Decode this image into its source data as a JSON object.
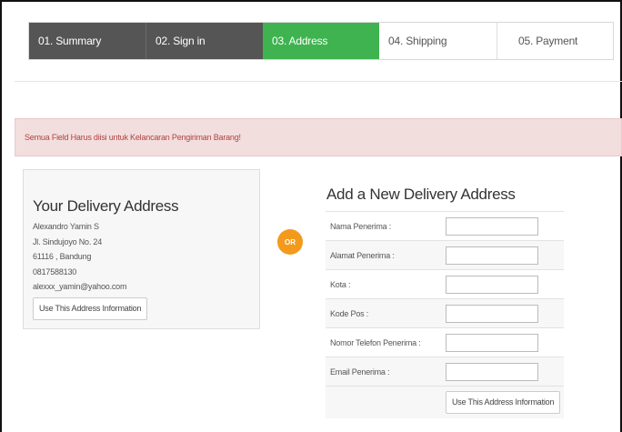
{
  "steps": [
    {
      "label": "01. Summary",
      "state": "done"
    },
    {
      "label": "02. Sign in",
      "state": "done"
    },
    {
      "label": "03. Address",
      "state": "active"
    },
    {
      "label": "04. Shipping",
      "state": "todo"
    },
    {
      "label": "05. Payment",
      "state": "todo"
    }
  ],
  "alert": {
    "message": "Semua Field Harus diisi untuk Kelancaran Pengiriman Barang!"
  },
  "delivery_address": {
    "title": "Your Delivery Address",
    "name": "Alexandro Yamin S",
    "street": "Jl. Sindujoyo No. 24",
    "city": "61116 , Bandung",
    "phone": "0817588130",
    "email": "alexxx_yamin@yahoo.com",
    "button_label": "Use This Address Information"
  },
  "or_label": "OR",
  "new_address": {
    "title": "Add a New Delivery Address",
    "fields": {
      "nama": {
        "label": "Nama Penerima :",
        "value": ""
      },
      "alamat": {
        "label": "Alamat Penerima :",
        "value": ""
      },
      "kota": {
        "label": "Kota :",
        "value": ""
      },
      "kodepos": {
        "label": "Kode Pos :",
        "value": ""
      },
      "telefon": {
        "label": "Nomor Telefon Penerima :",
        "value": ""
      },
      "email": {
        "label": "Email Penerima :",
        "value": ""
      }
    },
    "button_label": "Use This Address Information"
  },
  "colors": {
    "step_done": "#555555",
    "step_active": "#3eb34f",
    "alert_bg": "#f3dede",
    "alert_text": "#b04040",
    "or_badge": "#f39a1c"
  }
}
